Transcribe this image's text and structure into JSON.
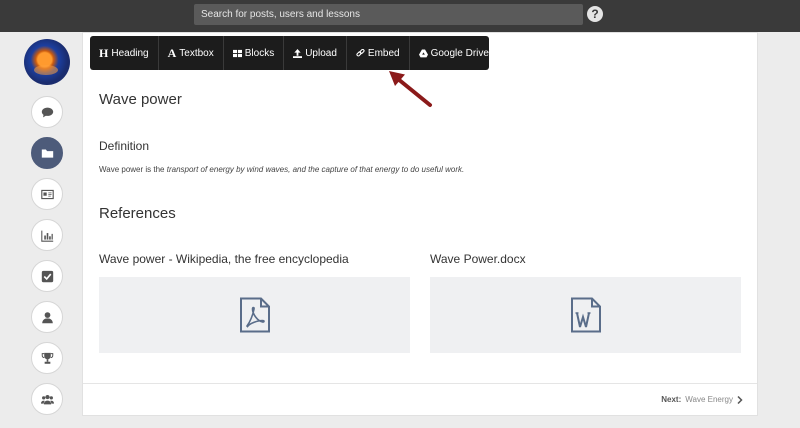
{
  "topbar": {
    "search_placeholder": "Search for posts, users and lessons",
    "help_label": "?"
  },
  "sidebar": {
    "items": [
      {
        "name": "comments",
        "icon": "comment-icon",
        "active": false
      },
      {
        "name": "folder",
        "icon": "folder-icon",
        "active": true
      },
      {
        "name": "id-card",
        "icon": "id-card-icon",
        "active": false
      },
      {
        "name": "stats",
        "icon": "bar-chart-icon",
        "active": false
      },
      {
        "name": "tasks",
        "icon": "check-square-icon",
        "active": false
      },
      {
        "name": "profile",
        "icon": "user-icon",
        "active": false
      },
      {
        "name": "awards",
        "icon": "trophy-icon",
        "active": false
      },
      {
        "name": "groups",
        "icon": "users-icon",
        "active": false
      }
    ]
  },
  "toolbar": {
    "heading": "Heading",
    "textbox": "Textbox",
    "blocks": "Blocks",
    "upload": "Upload",
    "embed": "Embed",
    "google_drive": "Google Drive"
  },
  "content": {
    "title": "Wave power",
    "definition_heading": "Definition",
    "definition_lead": "Wave power is the ",
    "definition_body": "transport of energy by wind waves, and the capture of that energy to do useful work.",
    "references_heading": "References",
    "references": [
      {
        "title": "Wave power - Wikipedia, the free encyclopedia",
        "icon": "pdf-file-icon"
      },
      {
        "title": "Wave Power.docx",
        "icon": "word-file-icon"
      }
    ]
  },
  "footer": {
    "next_label": "Next:",
    "next_title": "Wave Energy"
  },
  "colors": {
    "topbar": "#3a3a3a",
    "toolbar": "#1c1c1c",
    "active": "#4d5b7a",
    "arrow": "#8b1a1a",
    "card": "#eff0f2"
  }
}
